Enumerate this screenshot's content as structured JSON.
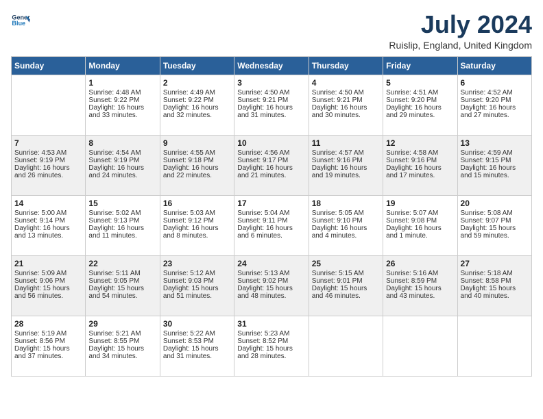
{
  "header": {
    "logo_line1": "General",
    "logo_line2": "Blue",
    "title": "July 2024",
    "location": "Ruislip, England, United Kingdom"
  },
  "weekdays": [
    "Sunday",
    "Monday",
    "Tuesday",
    "Wednesday",
    "Thursday",
    "Friday",
    "Saturday"
  ],
  "weeks": [
    [
      {
        "day": "",
        "sunrise": "",
        "sunset": "",
        "daylight": ""
      },
      {
        "day": "1",
        "sunrise": "Sunrise: 4:48 AM",
        "sunset": "Sunset: 9:22 PM",
        "daylight": "Daylight: 16 hours and 33 minutes."
      },
      {
        "day": "2",
        "sunrise": "Sunrise: 4:49 AM",
        "sunset": "Sunset: 9:22 PM",
        "daylight": "Daylight: 16 hours and 32 minutes."
      },
      {
        "day": "3",
        "sunrise": "Sunrise: 4:50 AM",
        "sunset": "Sunset: 9:21 PM",
        "daylight": "Daylight: 16 hours and 31 minutes."
      },
      {
        "day": "4",
        "sunrise": "Sunrise: 4:50 AM",
        "sunset": "Sunset: 9:21 PM",
        "daylight": "Daylight: 16 hours and 30 minutes."
      },
      {
        "day": "5",
        "sunrise": "Sunrise: 4:51 AM",
        "sunset": "Sunset: 9:20 PM",
        "daylight": "Daylight: 16 hours and 29 minutes."
      },
      {
        "day": "6",
        "sunrise": "Sunrise: 4:52 AM",
        "sunset": "Sunset: 9:20 PM",
        "daylight": "Daylight: 16 hours and 27 minutes."
      }
    ],
    [
      {
        "day": "7",
        "sunrise": "Sunrise: 4:53 AM",
        "sunset": "Sunset: 9:19 PM",
        "daylight": "Daylight: 16 hours and 26 minutes."
      },
      {
        "day": "8",
        "sunrise": "Sunrise: 4:54 AM",
        "sunset": "Sunset: 9:19 PM",
        "daylight": "Daylight: 16 hours and 24 minutes."
      },
      {
        "day": "9",
        "sunrise": "Sunrise: 4:55 AM",
        "sunset": "Sunset: 9:18 PM",
        "daylight": "Daylight: 16 hours and 22 minutes."
      },
      {
        "day": "10",
        "sunrise": "Sunrise: 4:56 AM",
        "sunset": "Sunset: 9:17 PM",
        "daylight": "Daylight: 16 hours and 21 minutes."
      },
      {
        "day": "11",
        "sunrise": "Sunrise: 4:57 AM",
        "sunset": "Sunset: 9:16 PM",
        "daylight": "Daylight: 16 hours and 19 minutes."
      },
      {
        "day": "12",
        "sunrise": "Sunrise: 4:58 AM",
        "sunset": "Sunset: 9:16 PM",
        "daylight": "Daylight: 16 hours and 17 minutes."
      },
      {
        "day": "13",
        "sunrise": "Sunrise: 4:59 AM",
        "sunset": "Sunset: 9:15 PM",
        "daylight": "Daylight: 16 hours and 15 minutes."
      }
    ],
    [
      {
        "day": "14",
        "sunrise": "Sunrise: 5:00 AM",
        "sunset": "Sunset: 9:14 PM",
        "daylight": "Daylight: 16 hours and 13 minutes."
      },
      {
        "day": "15",
        "sunrise": "Sunrise: 5:02 AM",
        "sunset": "Sunset: 9:13 PM",
        "daylight": "Daylight: 16 hours and 11 minutes."
      },
      {
        "day": "16",
        "sunrise": "Sunrise: 5:03 AM",
        "sunset": "Sunset: 9:12 PM",
        "daylight": "Daylight: 16 hours and 8 minutes."
      },
      {
        "day": "17",
        "sunrise": "Sunrise: 5:04 AM",
        "sunset": "Sunset: 9:11 PM",
        "daylight": "Daylight: 16 hours and 6 minutes."
      },
      {
        "day": "18",
        "sunrise": "Sunrise: 5:05 AM",
        "sunset": "Sunset: 9:10 PM",
        "daylight": "Daylight: 16 hours and 4 minutes."
      },
      {
        "day": "19",
        "sunrise": "Sunrise: 5:07 AM",
        "sunset": "Sunset: 9:08 PM",
        "daylight": "Daylight: 16 hours and 1 minute."
      },
      {
        "day": "20",
        "sunrise": "Sunrise: 5:08 AM",
        "sunset": "Sunset: 9:07 PM",
        "daylight": "Daylight: 15 hours and 59 minutes."
      }
    ],
    [
      {
        "day": "21",
        "sunrise": "Sunrise: 5:09 AM",
        "sunset": "Sunset: 9:06 PM",
        "daylight": "Daylight: 15 hours and 56 minutes."
      },
      {
        "day": "22",
        "sunrise": "Sunrise: 5:11 AM",
        "sunset": "Sunset: 9:05 PM",
        "daylight": "Daylight: 15 hours and 54 minutes."
      },
      {
        "day": "23",
        "sunrise": "Sunrise: 5:12 AM",
        "sunset": "Sunset: 9:03 PM",
        "daylight": "Daylight: 15 hours and 51 minutes."
      },
      {
        "day": "24",
        "sunrise": "Sunrise: 5:13 AM",
        "sunset": "Sunset: 9:02 PM",
        "daylight": "Daylight: 15 hours and 48 minutes."
      },
      {
        "day": "25",
        "sunrise": "Sunrise: 5:15 AM",
        "sunset": "Sunset: 9:01 PM",
        "daylight": "Daylight: 15 hours and 46 minutes."
      },
      {
        "day": "26",
        "sunrise": "Sunrise: 5:16 AM",
        "sunset": "Sunset: 8:59 PM",
        "daylight": "Daylight: 15 hours and 43 minutes."
      },
      {
        "day": "27",
        "sunrise": "Sunrise: 5:18 AM",
        "sunset": "Sunset: 8:58 PM",
        "daylight": "Daylight: 15 hours and 40 minutes."
      }
    ],
    [
      {
        "day": "28",
        "sunrise": "Sunrise: 5:19 AM",
        "sunset": "Sunset: 8:56 PM",
        "daylight": "Daylight: 15 hours and 37 minutes."
      },
      {
        "day": "29",
        "sunrise": "Sunrise: 5:21 AM",
        "sunset": "Sunset: 8:55 PM",
        "daylight": "Daylight: 15 hours and 34 minutes."
      },
      {
        "day": "30",
        "sunrise": "Sunrise: 5:22 AM",
        "sunset": "Sunset: 8:53 PM",
        "daylight": "Daylight: 15 hours and 31 minutes."
      },
      {
        "day": "31",
        "sunrise": "Sunrise: 5:23 AM",
        "sunset": "Sunset: 8:52 PM",
        "daylight": "Daylight: 15 hours and 28 minutes."
      },
      {
        "day": "",
        "sunrise": "",
        "sunset": "",
        "daylight": ""
      },
      {
        "day": "",
        "sunrise": "",
        "sunset": "",
        "daylight": ""
      },
      {
        "day": "",
        "sunrise": "",
        "sunset": "",
        "daylight": ""
      }
    ]
  ]
}
